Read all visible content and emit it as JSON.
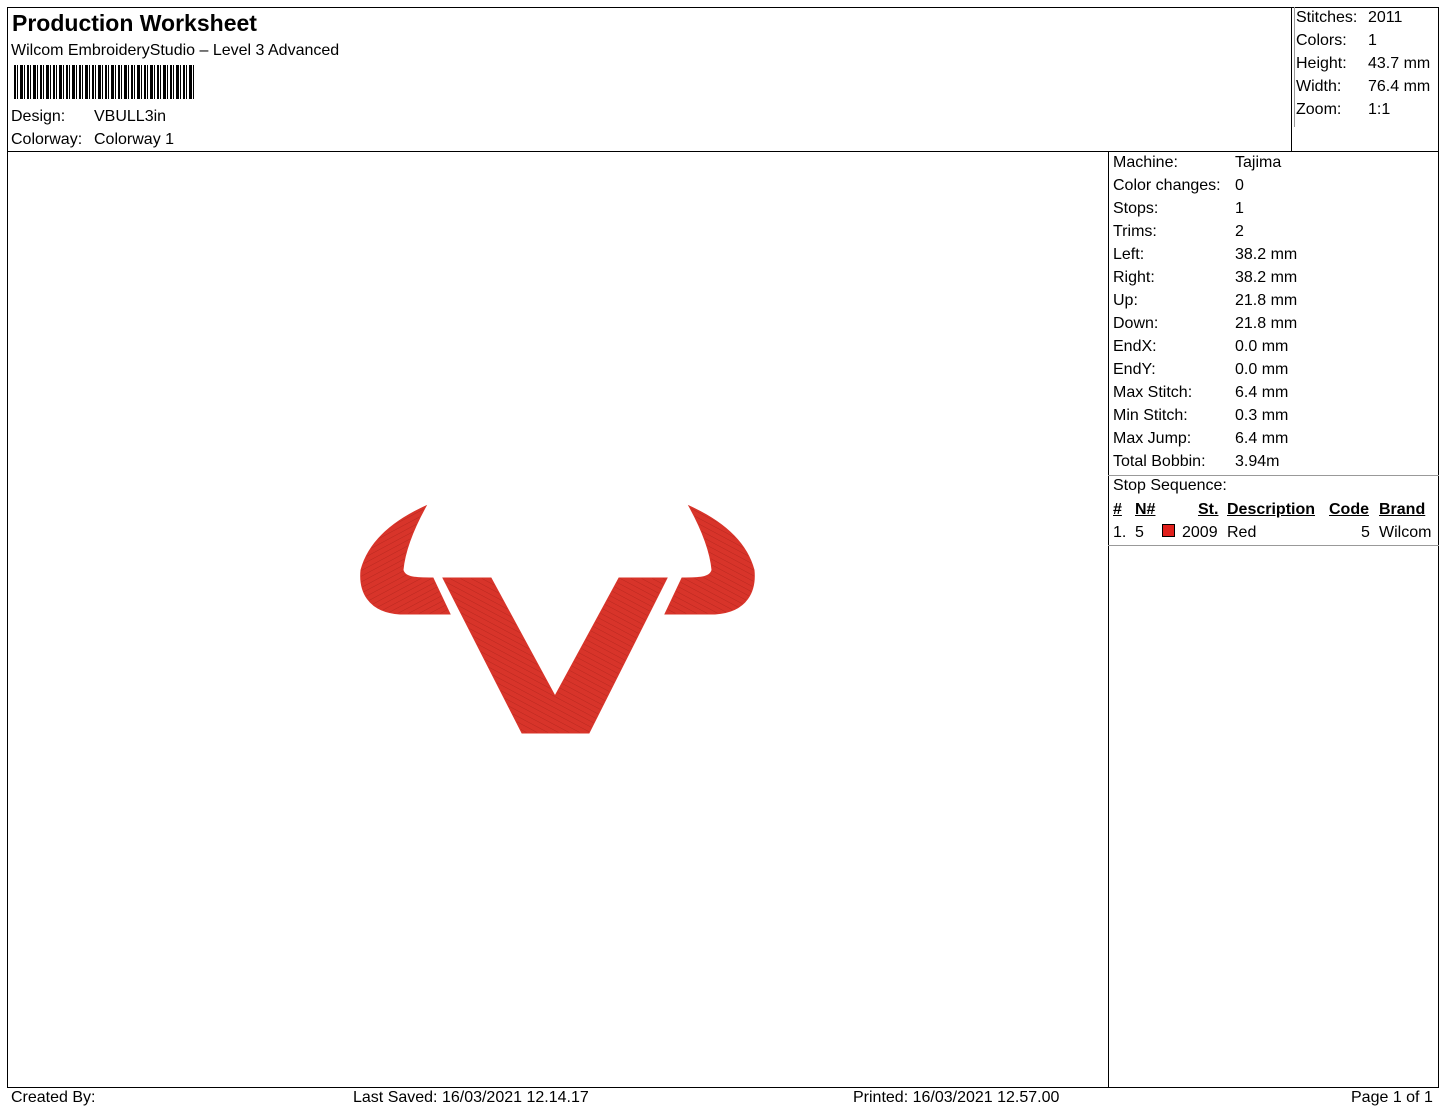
{
  "header": {
    "title": "Production Worksheet",
    "software": "Wilcom EmbroideryStudio – Level 3 Advanced",
    "design_label": "Design:",
    "design_value": "VBULL3in",
    "colorway_label": "Colorway:",
    "colorway_value": "Colorway 1"
  },
  "summary": {
    "stitches_label": "Stitches:",
    "stitches_value": "2011",
    "colors_label": "Colors:",
    "colors_value": "1",
    "height_label": "Height:",
    "height_value": "43.7 mm",
    "width_label": "Width:",
    "width_value": "76.4 mm",
    "zoom_label": "Zoom:",
    "zoom_value": "1:1"
  },
  "details": [
    {
      "label": "Machine:",
      "value": "Tajima"
    },
    {
      "label": "Color changes:",
      "value": "0"
    },
    {
      "label": "Stops:",
      "value": "1"
    },
    {
      "label": "Trims:",
      "value": "2"
    },
    {
      "label": "Left:",
      "value": "38.2 mm"
    },
    {
      "label": "Right:",
      "value": "38.2 mm"
    },
    {
      "label": "Up:",
      "value": "21.8 mm"
    },
    {
      "label": "Down:",
      "value": "21.8 mm"
    },
    {
      "label": "EndX:",
      "value": "0.0 mm"
    },
    {
      "label": "EndY:",
      "value": "0.0 mm"
    },
    {
      "label": "Max Stitch:",
      "value": "6.4 mm"
    },
    {
      "label": "Min Stitch:",
      "value": "0.3 mm"
    },
    {
      "label": "Max Jump:",
      "value": "6.4 mm"
    },
    {
      "label": "Total Bobbin:",
      "value": "3.94m"
    }
  ],
  "stop_sequence": {
    "title": "Stop Sequence:",
    "columns": {
      "num": "#",
      "n": "N#",
      "st": "St.",
      "description": "Description",
      "code": "Code",
      "brand": "Brand"
    },
    "rows": [
      {
        "num": "1.",
        "n": "5",
        "swatch_color": "#e0201c",
        "st": "2009",
        "description": "Red",
        "code": "5",
        "brand": "Wilcom"
      }
    ]
  },
  "design_color": "#d8342a",
  "footer": {
    "created_by": "Created By:",
    "last_saved": "Last Saved: 16/03/2021 12.14.17",
    "printed": "Printed: 16/03/2021 12.57.00",
    "page": "Page 1 of 1"
  }
}
